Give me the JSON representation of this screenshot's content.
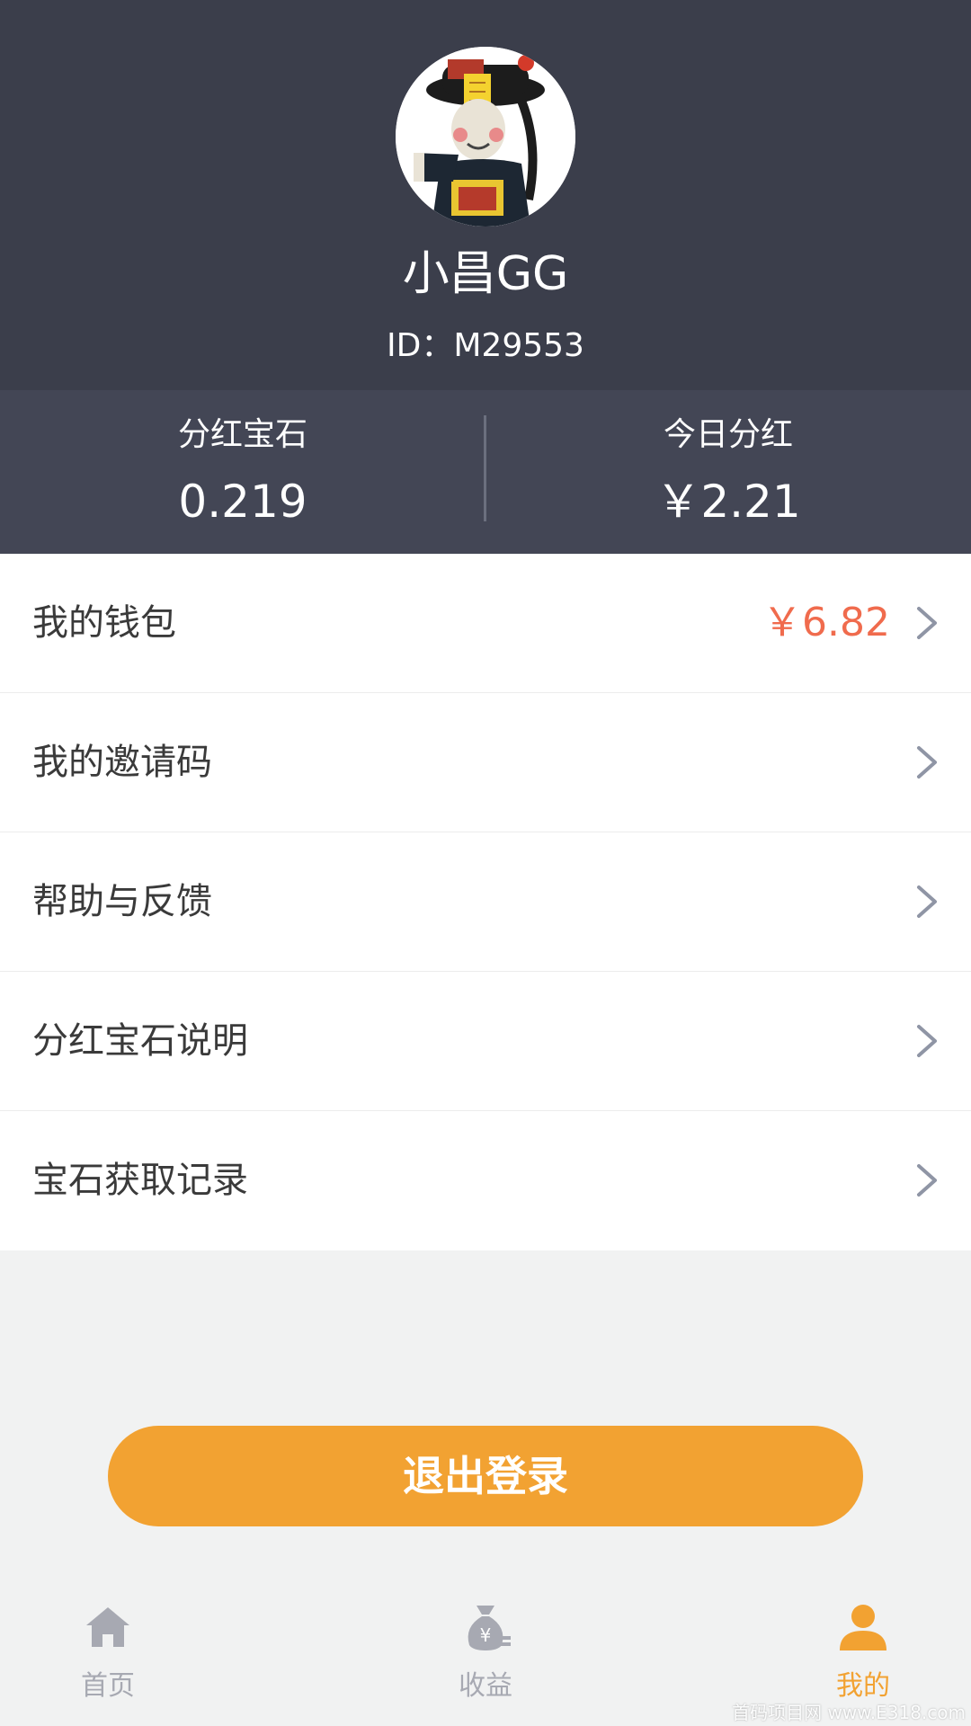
{
  "profile": {
    "name": "小昌GG",
    "id_text": "ID：M29553"
  },
  "stats": {
    "gems_label": "分红宝石",
    "gems_value": "0.219",
    "today_label": "今日分红",
    "today_value": "￥2.21"
  },
  "menu": {
    "items": [
      {
        "label": "我的钱包",
        "value": "￥6.82"
      },
      {
        "label": "我的邀请码"
      },
      {
        "label": "帮助与反馈"
      },
      {
        "label": "分红宝石说明"
      },
      {
        "label": "宝石获取记录"
      }
    ]
  },
  "logout_label": "退出登录",
  "tabbar": {
    "tabs": [
      {
        "label": "首页",
        "icon": "home-icon"
      },
      {
        "label": "收益",
        "icon": "money-bag-icon"
      },
      {
        "label": "我的",
        "icon": "person-icon",
        "active": true
      }
    ]
  },
  "watermark": "首码项目网 www.E318.com",
  "colors": {
    "header_bg": "#3b3e4b",
    "stats_bg": "#434655",
    "accent": "#f2a232",
    "price_red": "#f06b4d",
    "tab_inactive": "#a7a9b2"
  }
}
